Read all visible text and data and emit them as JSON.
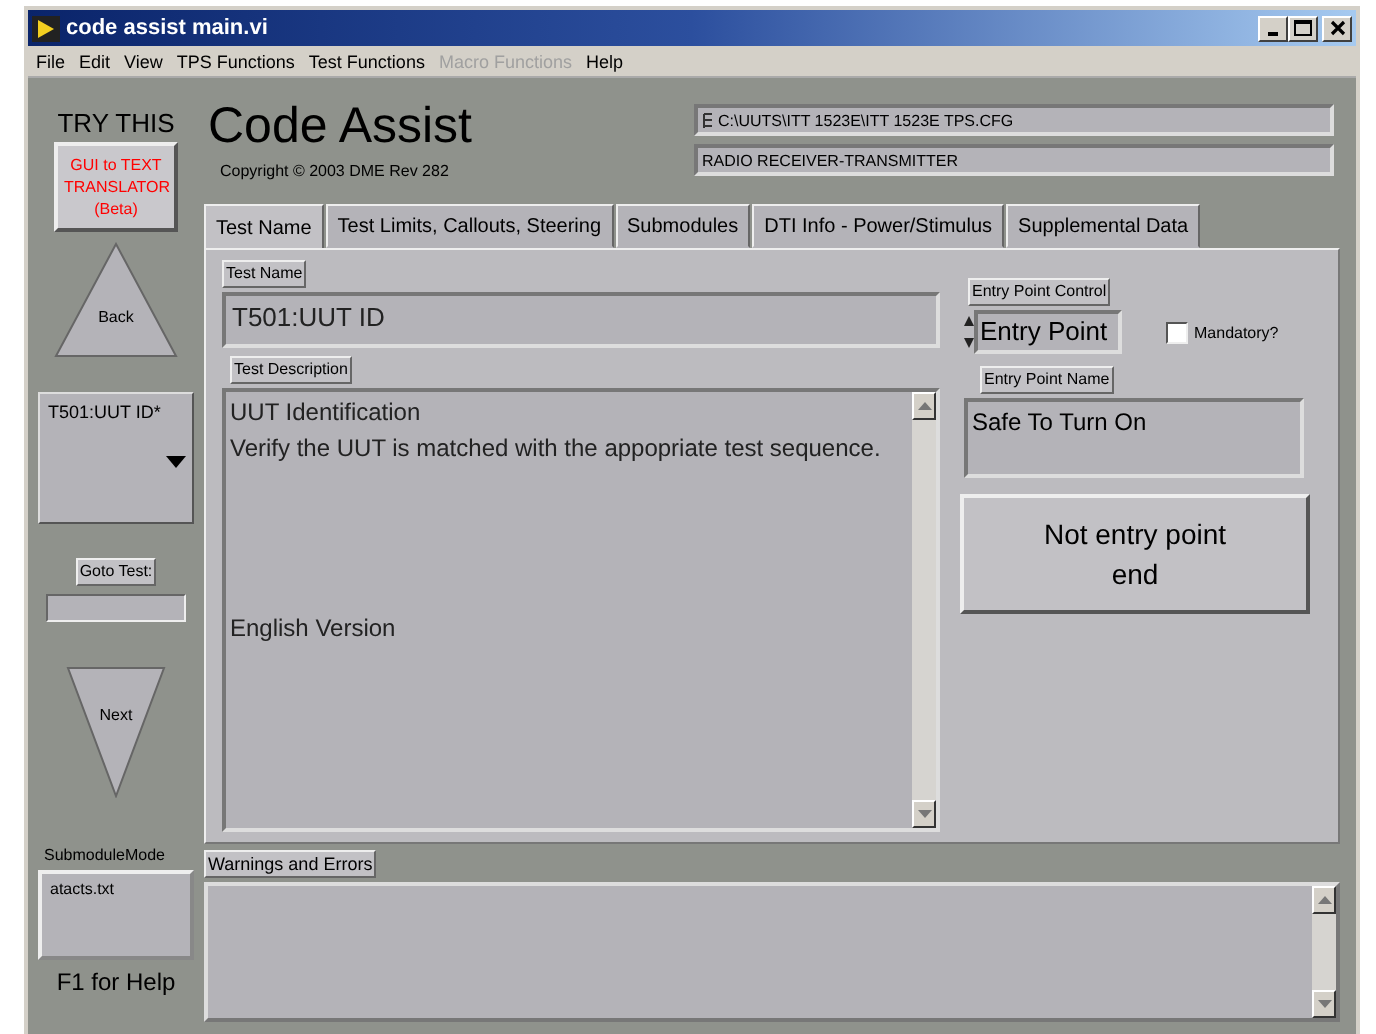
{
  "window": {
    "title": "code assist main.vi"
  },
  "menu": [
    {
      "label": "File",
      "disabled": false
    },
    {
      "label": "Edit",
      "disabled": false
    },
    {
      "label": "View",
      "disabled": false
    },
    {
      "label": "TPS Functions",
      "disabled": false
    },
    {
      "label": "Test Functions",
      "disabled": false
    },
    {
      "label": "Macro Functions",
      "disabled": true
    },
    {
      "label": "Help",
      "disabled": false
    }
  ],
  "sidebar": {
    "try_this": "TRY THIS",
    "translator_button": "GUI to TEXT TRANSLATOR (Beta)",
    "back_button": "Back",
    "test_selector": "T501:UUT ID*",
    "goto_label": "Goto Test:",
    "next_button": "Next",
    "submodule_label": "SubmoduleMode",
    "submodule_value": "atacts.txt",
    "help_hint": "F1 for Help"
  },
  "header": {
    "title": "Code Assist",
    "copyright": "Copyright © 2003 DME Rev 282",
    "config_path": "C:\\UUTS\\ITT 1523E\\ITT 1523E TPS.CFG",
    "uut_name": "RADIO RECEIVER-TRANSMITTER"
  },
  "tabs": [
    {
      "label": "Test Name",
      "selected": true
    },
    {
      "label": "Test Limits, Callouts, Steering",
      "selected": false
    },
    {
      "label": "Submodules",
      "selected": false
    },
    {
      "label": "DTI Info - Power/Stimulus",
      "selected": false
    },
    {
      "label": "Supplemental Data",
      "selected": false
    }
  ],
  "test_name": {
    "label": "Test Name",
    "value": "T501:UUT ID"
  },
  "test_description": {
    "label": "Test Description",
    "value": "UUT Identification\nVerify the UUT is matched with the appopriate test sequence.\n\n\n\n\nEnglish Version"
  },
  "entry_point": {
    "control_label": "Entry Point Control",
    "control_value": "Entry Point",
    "mandatory_label": "Mandatory?",
    "mandatory_checked": false,
    "name_label": "Entry Point Name",
    "name_value": "Safe To Turn On",
    "end_button": "Not entry point end"
  },
  "warnings": {
    "label": "Warnings and Errors"
  }
}
